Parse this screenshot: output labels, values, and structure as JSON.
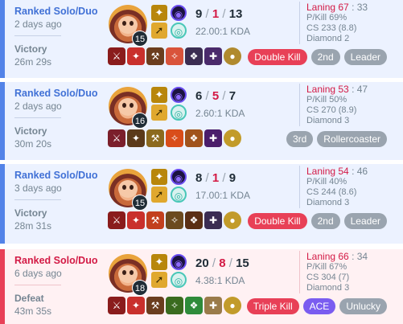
{
  "matches": [
    {
      "queue": "Ranked Solo/Duo",
      "time_ago": "2 days ago",
      "result": "Victory",
      "duration": "26m 29s",
      "level": "15",
      "kills": "9",
      "deaths": "1",
      "assists": "13",
      "kda_ratio": "22.00:1 KDA",
      "laning_label": "Laning 67",
      "laning_opp": ": 33",
      "p_kill": "P/Kill 69%",
      "cs": "CS 233 (8.8)",
      "rank": "Diamond 2",
      "badges": [
        "Double Kill",
        "2nd",
        "Leader"
      ],
      "outcome": "win"
    },
    {
      "queue": "Ranked Solo/Duo",
      "time_ago": "2 days ago",
      "result": "Victory",
      "duration": "30m 20s",
      "level": "16",
      "kills": "6",
      "deaths": "5",
      "assists": "7",
      "kda_ratio": "2.60:1 KDA",
      "laning_label": "Laning 53",
      "laning_opp": ": 47",
      "p_kill": "P/Kill 50%",
      "cs": "CS 270 (8.9)",
      "rank": "Diamond 3",
      "badges": [
        "3rd",
        "Rollercoaster"
      ],
      "outcome": "win"
    },
    {
      "queue": "Ranked Solo/Duo",
      "time_ago": "3 days ago",
      "result": "Victory",
      "duration": "28m 31s",
      "level": "15",
      "kills": "8",
      "deaths": "1",
      "assists": "9",
      "kda_ratio": "17.00:1 KDA",
      "laning_label": "Laning 54",
      "laning_opp": ": 46",
      "p_kill": "P/Kill 40%",
      "cs": "CS 244 (8.6)",
      "rank": "Diamond 3",
      "badges": [
        "Double Kill",
        "2nd",
        "Leader"
      ],
      "outcome": "win"
    },
    {
      "queue": "Ranked Solo/Duo",
      "time_ago": "6 days ago",
      "result": "Defeat",
      "duration": "43m 35s",
      "level": "18",
      "kills": "20",
      "deaths": "8",
      "assists": "15",
      "kda_ratio": "4.38:1 KDA",
      "laning_label": "Laning 66",
      "laning_opp": ": 34",
      "p_kill": "P/Kill 67%",
      "cs": "CS 304 (7)",
      "rank": "Diamond 3",
      "badges": [
        "Triple Kill",
        "ACE",
        "Unlucky"
      ],
      "outcome": "loss"
    }
  ],
  "icons": {
    "champion": "champion-portrait-icon",
    "spell_1": "flash-spell-icon",
    "spell_2": "ignite-spell-icon",
    "rune_primary": "primary-rune-icon",
    "rune_secondary": "secondary-rune-icon",
    "trinket": "trinket-ward-icon"
  },
  "colors": {
    "win_accent": "#5383e8",
    "win_bg": "#ecf2ff",
    "loss_accent": "#e84057",
    "loss_bg": "#fff1f3",
    "multikill_badge": "#e84057",
    "ace_badge": "#7a5cf0",
    "neutral_badge": "#9aa4af"
  }
}
